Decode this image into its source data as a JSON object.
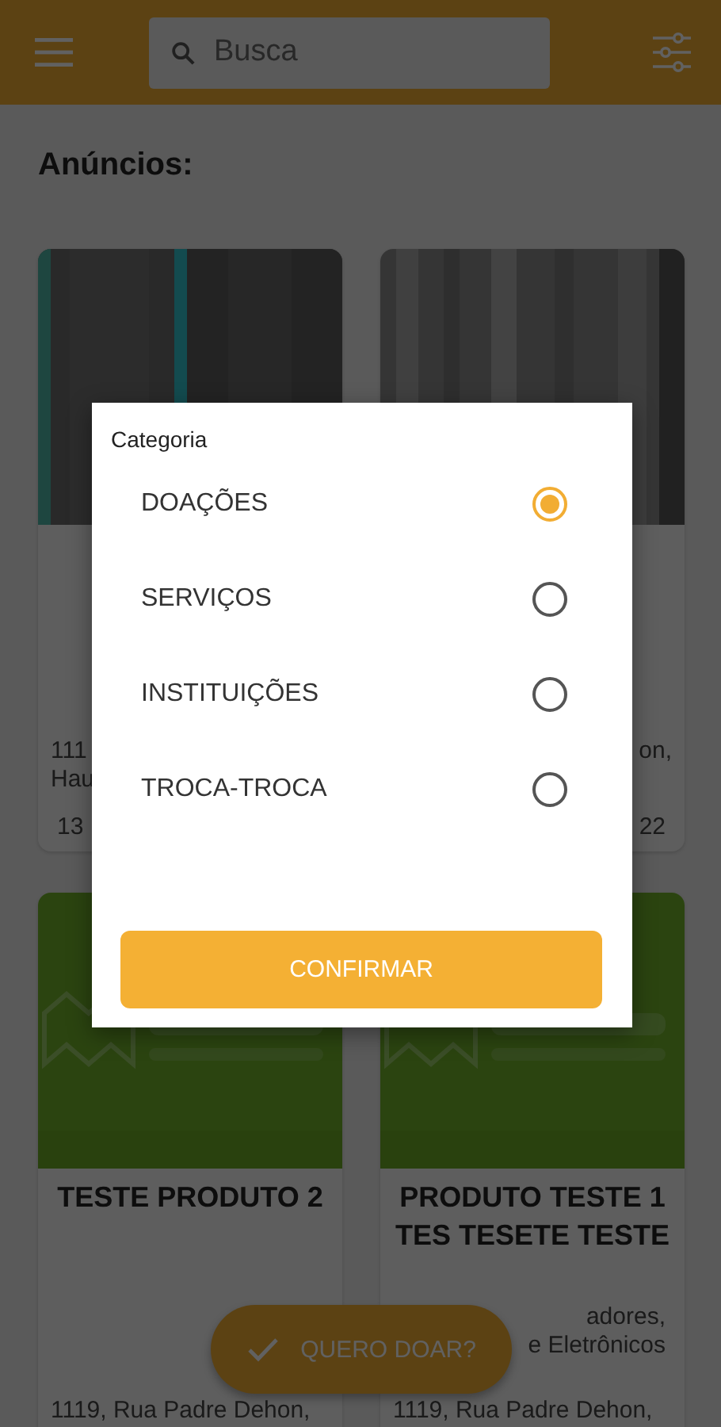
{
  "header": {
    "search": {
      "placeholder": "Busca"
    }
  },
  "section_title": "Anúncios:",
  "top_listings": [
    {
      "address_lines": [
        "111",
        "Hau"
      ],
      "date": "13"
    },
    {
      "address_lines": [
        "on,"
      ],
      "date": "22"
    }
  ],
  "bottom_listings": [
    {
      "title": "TESTE PRODUTO 2",
      "address": "1119, Rua Padre Dehon,"
    },
    {
      "title": "PRODUTO TESTE 1 TES TESETE TESTE",
      "category_lines": [
        "adores,",
        "e Eletrônicos"
      ],
      "address": "1119, Rua Padre Dehon,"
    }
  ],
  "dialog": {
    "title": "Categoria",
    "options": [
      {
        "label": "DOAÇÕES",
        "selected": true
      },
      {
        "label": "SERVIÇOS",
        "selected": false
      },
      {
        "label": "INSTITUIÇÕES",
        "selected": false
      },
      {
        "label": "TROCA-TROCA",
        "selected": false
      }
    ],
    "button": "CONFIRMAR"
  },
  "fab": {
    "label": "QUERO DOAR?"
  }
}
